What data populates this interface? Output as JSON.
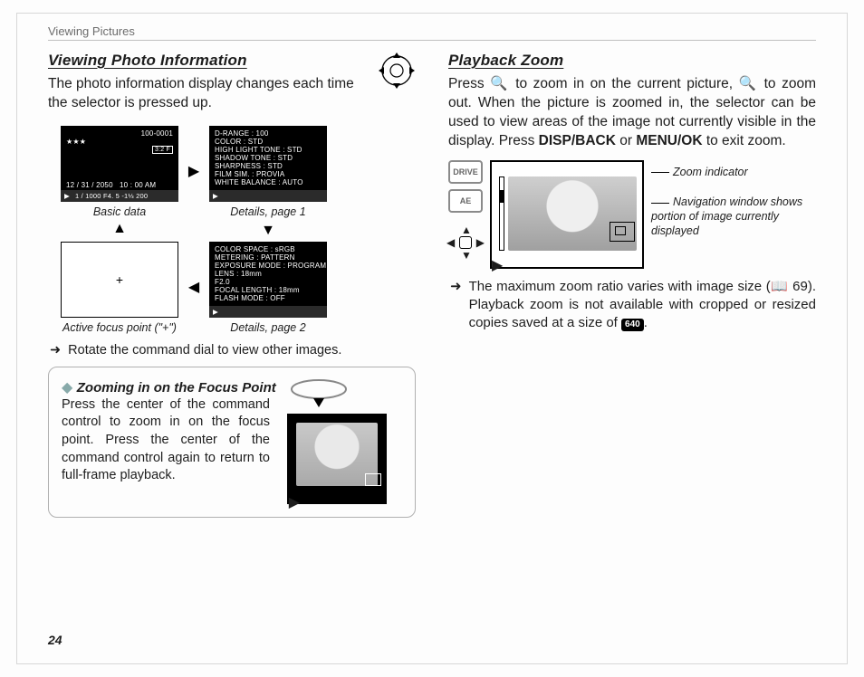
{
  "running_head": "Viewing Pictures",
  "page_number": "24",
  "left": {
    "title": "Viewing Photo Information",
    "intro": "The photo information display changes each time the selector is pressed up.",
    "basic": {
      "file_no": "100-0001",
      "stars": "★★★",
      "ratio_badge": "3:2 F",
      "date": "12 / 31 / 2050",
      "time": "10 : 00  AM",
      "status": "1 / 1000   F4. 5   -1⅓  200"
    },
    "captions": {
      "basic": "Basic data",
      "d1": "Details, page 1",
      "active": "Active focus point (\"+\")",
      "d2": "Details, page 2"
    },
    "details1": [
      "D-RANGE : 100",
      "COLOR : STD",
      "HIGH LIGHT TONE : STD",
      "SHADOW TONE : STD",
      "SHARPNESS : STD",
      "FILM SIM. : PROVIA",
      "WHITE BALANCE : AUTO"
    ],
    "details2": [
      "COLOR SPACE : sRGB",
      "METERING : PATTERN",
      "EXPOSURE MODE : PROGRAM",
      "LENS : 18mm",
      " F2.0",
      "FOCAL LENGTH : 18mm",
      "FLASH MODE : OFF"
    ],
    "rotate_tip": "Rotate the command dial to view other images.",
    "callout": {
      "title": "Zooming in on the Focus Point",
      "body": "Press the center of the command control to zoom in on the focus point.  Press the center of the command control again to return to full-frame playback."
    }
  },
  "right": {
    "title": "Playback Zoom",
    "para_a": "Press ",
    "para_b": " to zoom in on the current picture, ",
    "para_c": " to zoom out.  When the picture is zoomed in, the selector can be used to view areas of the image not currently visible in the display.  Press ",
    "disp": "DISP/BACK",
    "para_d": " or ",
    "menuok": "MENU/OK",
    "para_e": " to exit zoom.",
    "dial1": "DRIVE",
    "dial2": "AE",
    "zoom_label": "Zoom indicator",
    "nav_label": "Navigation window shows portion of image currently displayed",
    "note_a": "The maximum zoom ratio varies with image size (",
    "note_page": "69",
    "note_b": ").  Playback zoom is not available with cropped or resized copies saved at a size of ",
    "note_pill": "640",
    "note_c": "."
  }
}
